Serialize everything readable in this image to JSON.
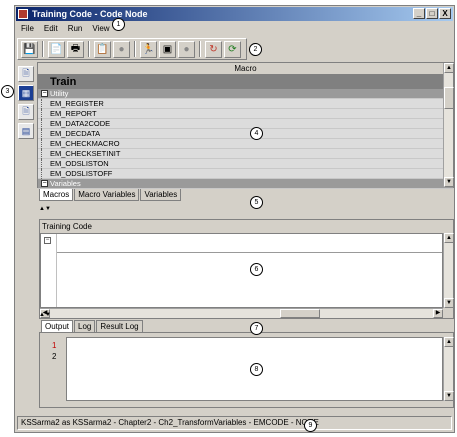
{
  "window": {
    "title": "Training Code - Code Node",
    "controls": [
      "_",
      "□",
      "X"
    ]
  },
  "menu": [
    "File",
    "Edit",
    "Run",
    "View"
  ],
  "toolbar": {
    "buttons": [
      "save-icon",
      "open-icon",
      "print-icon",
      "report-icon",
      "stop-icon",
      "run-icon",
      "results-icon",
      "disabled-icon",
      "refresh-icon",
      "cycle-icon"
    ]
  },
  "callouts": [
    "1",
    "2",
    "3",
    "4",
    "5",
    "6",
    "7",
    "8",
    "9"
  ],
  "macros": {
    "header": "Macro",
    "group_title": "Train",
    "group_utility": "Utility",
    "items": [
      "EM_REGISTER",
      "EM_REPORT",
      "EM_DATA2CODE",
      "EM_DECDATA",
      "EM_CHECKMACRO",
      "EM_CHECKSETINIT",
      "EM_ODSLISTON",
      "EM_ODSLISTOFF"
    ],
    "group_variables": "Variables"
  },
  "macro_tabs": [
    "Macros",
    "Macro Variables",
    "Variables"
  ],
  "code": {
    "label": "Training Code"
  },
  "output_tabs": [
    "Output",
    "Log",
    "Result Log"
  ],
  "output": {
    "line_numbers": [
      "1",
      "2"
    ]
  },
  "status": "KSSarma2 as KSSarma2 - Chapter2 - Ch2_TransformVariables - EMCODE - NONE",
  "colors": {
    "title_start": "#0a246a",
    "title_end": "#a6caf0",
    "chrome": "#d4d0c8",
    "line1_red": "#c00000"
  }
}
